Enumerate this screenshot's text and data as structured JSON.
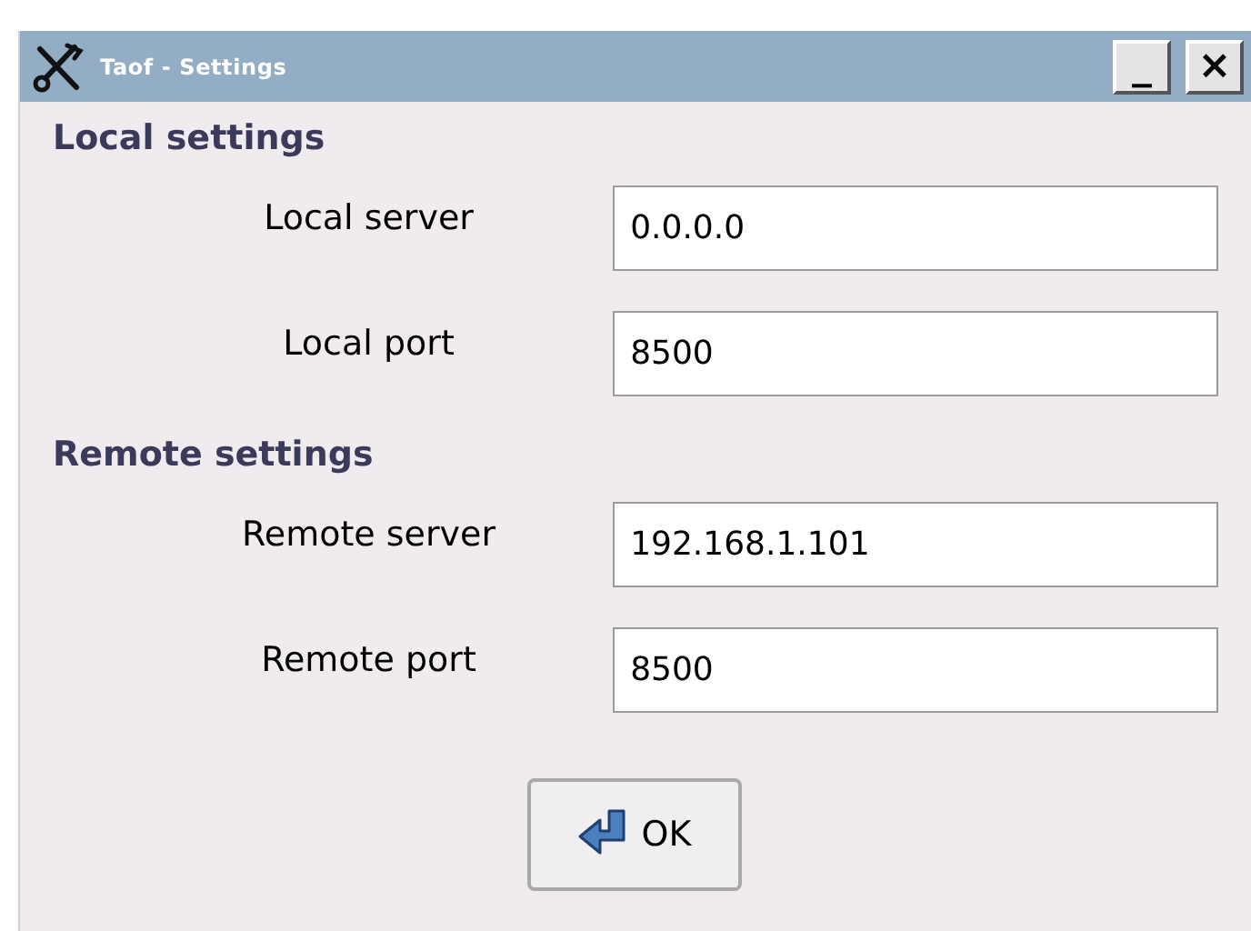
{
  "window": {
    "title": "Taof - Settings",
    "controls": [
      "_",
      "×"
    ]
  },
  "sections": [
    {
      "heading": "Local settings",
      "fields": [
        {
          "label": "Local server",
          "value": "0.0.0.0"
        },
        {
          "label": "Local port",
          "value": "8500"
        }
      ]
    },
    {
      "heading": "Remote settings",
      "fields": [
        {
          "label": "Remote server",
          "value": "192.168.1.101"
        },
        {
          "label": "Remote port",
          "value": "8500"
        }
      ]
    }
  ],
  "buttons": [
    "OK"
  ]
}
